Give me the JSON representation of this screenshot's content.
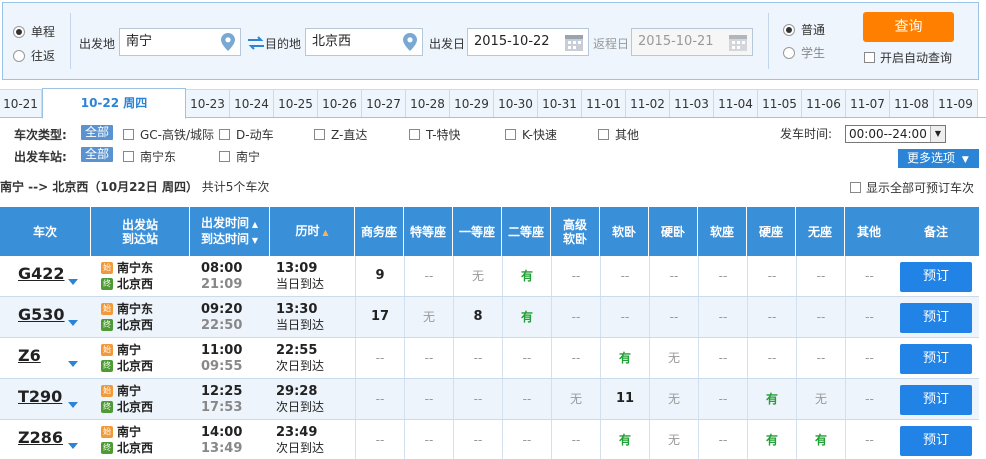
{
  "search": {
    "trip_types": [
      {
        "label": "单程",
        "checked": true
      },
      {
        "label": "往返",
        "checked": false
      }
    ],
    "from_label": "出发地",
    "from_value": "南宁",
    "to_label": "目的地",
    "to_value": "北京西",
    "depart_date_label": "出发日",
    "depart_date_value": "2015-10-22",
    "return_date_label": "返程日",
    "return_date_value": "2015-10-21",
    "passenger_types": [
      {
        "label": "普通",
        "checked": true
      },
      {
        "label": "学生",
        "checked": false
      }
    ],
    "query_label": "查询",
    "auto_query_label": "开启自动查询"
  },
  "date_tabs": [
    {
      "label": "10-21",
      "active": false
    },
    {
      "label": "10-22 周四",
      "active": true
    },
    {
      "label": "10-23",
      "active": false
    },
    {
      "label": "10-24",
      "active": false
    },
    {
      "label": "10-25",
      "active": false
    },
    {
      "label": "10-26",
      "active": false
    },
    {
      "label": "10-27",
      "active": false
    },
    {
      "label": "10-28",
      "active": false
    },
    {
      "label": "10-29",
      "active": false
    },
    {
      "label": "10-30",
      "active": false
    },
    {
      "label": "10-31",
      "active": false
    },
    {
      "label": "11-01",
      "active": false
    },
    {
      "label": "11-02",
      "active": false
    },
    {
      "label": "11-03",
      "active": false
    },
    {
      "label": "11-04",
      "active": false
    },
    {
      "label": "11-05",
      "active": false
    },
    {
      "label": "11-06",
      "active": false
    },
    {
      "label": "11-07",
      "active": false
    },
    {
      "label": "11-08",
      "active": false
    },
    {
      "label": "11-09",
      "active": false
    }
  ],
  "filters": {
    "train_type_label": "车次类型:",
    "all_label": "全部",
    "train_types": [
      "GC-高铁/城际",
      "D-动车",
      "Z-直达",
      "T-特快",
      "K-快速",
      "其他"
    ],
    "station_label": "出发车站:",
    "stations": [
      "南宁东",
      "南宁"
    ],
    "depart_time_label": "发车时间:",
    "depart_time_value": "00:00--24:00",
    "more_label": "更多选项"
  },
  "summary": {
    "route": "南宁 --> 北京西（10月22日 周四）",
    "count": "共计5个车次",
    "show_all_label": "显示全部可预订车次"
  },
  "table": {
    "headers": {
      "train": "车次",
      "station_top": "出发站",
      "station_bottom": "到达站",
      "time_top": "出发时间",
      "time_bottom": "到达时间",
      "duration": "历时",
      "seats": [
        "商务座",
        "特等座",
        "一等座",
        "二等座",
        "高级软卧",
        "软卧",
        "硬卧",
        "软座",
        "硬座",
        "无座",
        "其他"
      ],
      "remark": "备注"
    },
    "start_icon": "始",
    "end_icon": "终",
    "book_label": "预订",
    "rows": [
      {
        "train": "G422",
        "from": "南宁东",
        "to": "北京西",
        "dep": "08:00",
        "arr": "21:09",
        "dur": "13:09",
        "arrive_note": "当日到达",
        "seats": [
          "9",
          "--",
          "无",
          "有",
          "--",
          "--",
          "--",
          "--",
          "--",
          "--",
          "--"
        ]
      },
      {
        "train": "G530",
        "from": "南宁东",
        "to": "北京西",
        "dep": "09:20",
        "arr": "22:50",
        "dur": "13:30",
        "arrive_note": "当日到达",
        "seats": [
          "17",
          "无",
          "8",
          "有",
          "--",
          "--",
          "--",
          "--",
          "--",
          "--",
          "--"
        ]
      },
      {
        "train": "Z6",
        "from": "南宁",
        "to": "北京西",
        "dep": "11:00",
        "arr": "09:55",
        "dur": "22:55",
        "arrive_note": "次日到达",
        "seats": [
          "--",
          "--",
          "--",
          "--",
          "--",
          "有",
          "无",
          "--",
          "--",
          "--",
          "--"
        ]
      },
      {
        "train": "T290",
        "from": "南宁",
        "to": "北京西",
        "dep": "12:25",
        "arr": "17:53",
        "dur": "29:28",
        "arrive_note": "次日到达",
        "seats": [
          "--",
          "--",
          "--",
          "--",
          "无",
          "11",
          "无",
          "--",
          "有",
          "无",
          "--"
        ]
      },
      {
        "train": "Z286",
        "from": "南宁",
        "to": "北京西",
        "dep": "14:00",
        "arr": "13:49",
        "dur": "23:49",
        "arrive_note": "次日到达",
        "seats": [
          "--",
          "--",
          "--",
          "--",
          "--",
          "有",
          "无",
          "--",
          "有",
          "有",
          "--"
        ]
      }
    ]
  },
  "colors": {
    "accent": "#2b84d6",
    "query_button": "#ff7f00",
    "available": "#21a035"
  }
}
